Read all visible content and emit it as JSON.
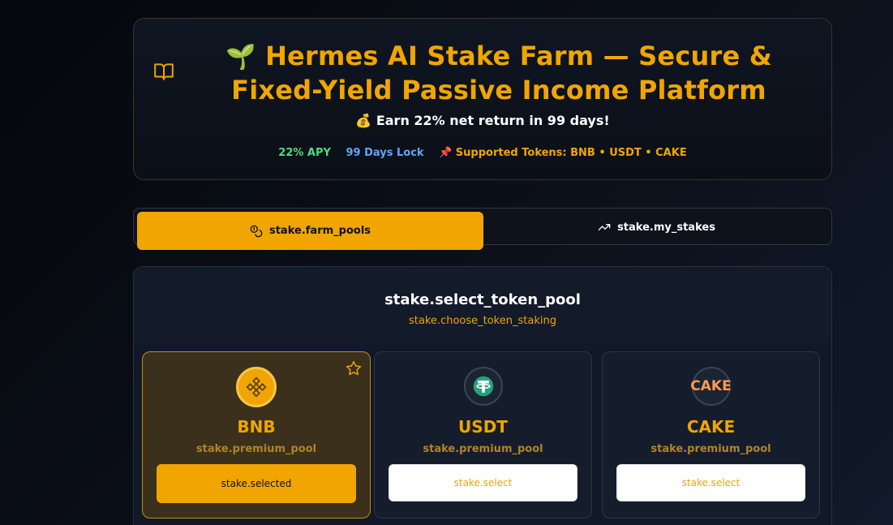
{
  "hero": {
    "title_emoji": "🌱",
    "title": "Hermes AI Stake Farm — Secure & Fixed-Yield Passive Income Platform",
    "subtitle": "💰 Earn 22% net return in 99 days!",
    "apy": "22% APY",
    "lock": "99 Days Lock",
    "tokens": "📌 Supported Tokens: BNB • USDT • CAKE"
  },
  "tabs": [
    {
      "label": "stake.farm_pools",
      "icon": "coins-icon",
      "active": true
    },
    {
      "label": "stake.my_stakes",
      "icon": "trending-up-icon",
      "active": false
    }
  ],
  "panel": {
    "title": "stake.select_token_pool",
    "subtitle": "stake.choose_token_staking"
  },
  "pools": [
    {
      "name": "BNB",
      "desc": "stake.premium_pool",
      "button": "stake.selected",
      "selected": true,
      "icon": "bnb-icon"
    },
    {
      "name": "USDT",
      "desc": "stake.premium_pool",
      "button": "stake.select",
      "selected": false,
      "icon": "usdt-icon"
    },
    {
      "name": "CAKE",
      "desc": "stake.premium_pool",
      "button": "stake.select",
      "selected": false,
      "icon": "cake-icon",
      "icon_text": "CAKE"
    }
  ],
  "colors": {
    "accent": "#f0a500",
    "apy": "#4ade80",
    "lock": "#60a5fa",
    "background": "#0a0e17"
  }
}
